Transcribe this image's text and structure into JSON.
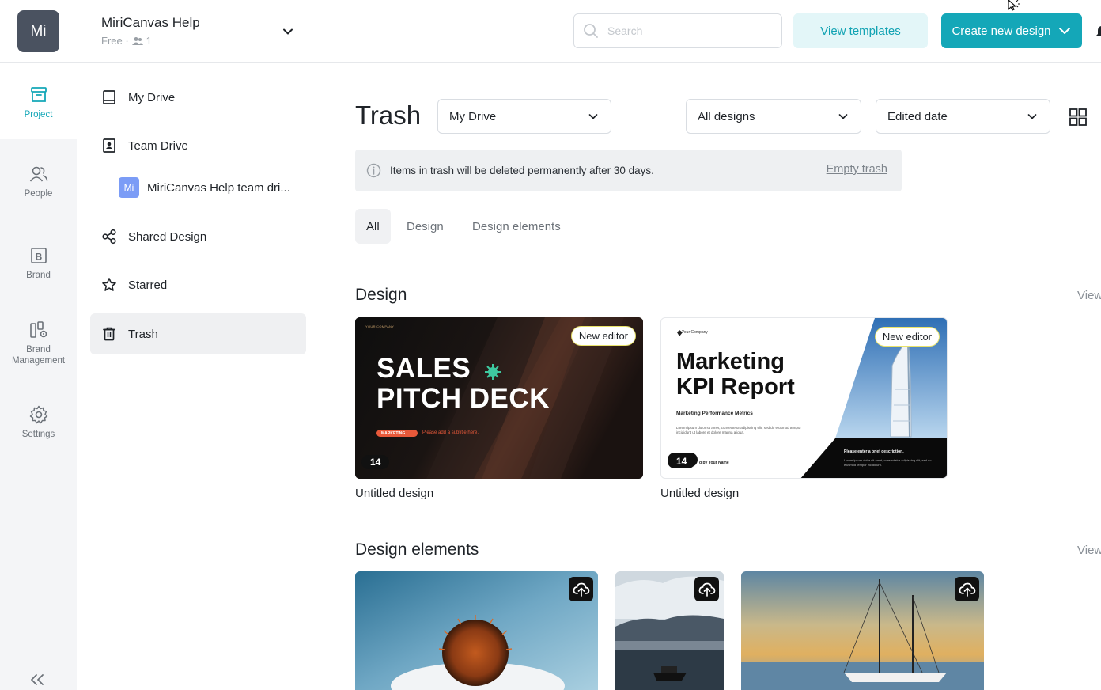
{
  "header": {
    "workspace_initials": "Mi",
    "workspace_name": "MiriCanvas Help",
    "plan": "Free ·",
    "member_count": "1",
    "search_placeholder": "Search",
    "view_templates_label": "View templates",
    "create_label": "Create new design"
  },
  "rail": {
    "items": [
      {
        "label": "Project",
        "icon": "archive-box-icon"
      },
      {
        "label": "People",
        "icon": "people-icon"
      },
      {
        "label": "Brand",
        "icon": "brand-b-icon"
      },
      {
        "label": "Brand Management",
        "icon": "brand-management-icon"
      },
      {
        "label": "Settings",
        "icon": "gear-icon"
      }
    ]
  },
  "nav": {
    "my_drive": "My Drive",
    "team_drive": "Team Drive",
    "team_badge": "Mi",
    "team_drive_name": "MiriCanvas Help team dri...",
    "shared_design": "Shared Design",
    "starred": "Starred",
    "trash": "Trash"
  },
  "main": {
    "title": "Trash",
    "drive_select": "My Drive",
    "type_select": "All designs",
    "sort_select": "Edited date",
    "notice": "Items in trash will be deleted permanently after 30 days.",
    "empty_trash": "Empty trash",
    "tabs": [
      {
        "label": "All",
        "active": true
      },
      {
        "label": "Design",
        "active": false
      },
      {
        "label": "Design elements",
        "active": false
      }
    ],
    "design_section": "Design",
    "view_all": "View",
    "elements_section": "Design elements",
    "designs": [
      {
        "label": "Untitled design",
        "badge": "New editor",
        "pages": "14",
        "thumb_company": "YOUR COMPANY",
        "thumb_line1": "SALES",
        "thumb_line2": "PITCH DECK",
        "thumb_tag": "MARKETING",
        "thumb_subtitle": "Please add a subtitle here."
      },
      {
        "label": "Untitled design",
        "badge": "New editor",
        "pages": "14",
        "thumb_company": "Your Company",
        "thumb_line1": "Marketing",
        "thumb_line2": "KPI Report",
        "thumb_sub": "Marketing Performance Metrics",
        "thumb_body": "Lorem ipsum dolor sit amet, consectetur adipiscing elit, sed do eiusmod tempor incididunt ut labore et dolore magna aliqua.",
        "thumb_by": "d by Your Name",
        "thumb_desc_title": "Please enter a brief description.",
        "thumb_desc_body": "Lorem ipsum dolor sit amet, consectetur adipiscing elit, sed do eiusmod tempor incididunt."
      }
    ]
  },
  "colors": {
    "accent": "#14a7b8",
    "accent_light": "#e3f6f8",
    "rail_bg": "#f4f5f7",
    "active_nav": "#eff0f2"
  }
}
